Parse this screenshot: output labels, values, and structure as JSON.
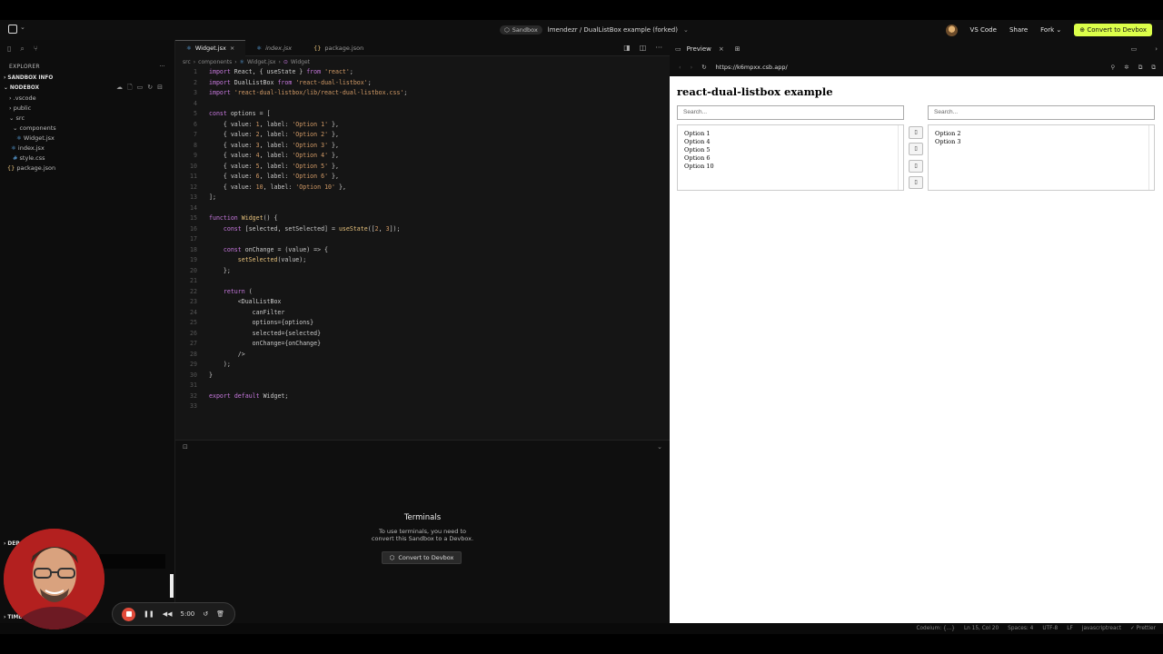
{
  "topbar": {
    "sandbox_label": "Sandbox",
    "project_path": "lmendezr / DualListBox example (forked)",
    "vscode_label": "VS Code",
    "share_label": "Share",
    "fork_label": "Fork",
    "convert_label": "Convert to Devbox"
  },
  "sidebar": {
    "explorer_title": "EXPLORER",
    "items": [
      {
        "label": "SANDBOX INFO",
        "arrow": "›"
      },
      {
        "label": "NODEBOX",
        "arrow": "⌄"
      },
      {
        "label": ".vscode",
        "arrow": "›"
      },
      {
        "label": "public",
        "arrow": "›"
      },
      {
        "label": "src",
        "arrow": "⌄"
      },
      {
        "label": "components",
        "arrow": "⌄"
      },
      {
        "label": "Widget.jsx",
        "icon": "⚛"
      },
      {
        "label": "index.jsx",
        "icon": "⚛"
      },
      {
        "label": "style.css",
        "icon": "#"
      },
      {
        "label": "package.json",
        "icon": "{}"
      }
    ],
    "deps_label": "DEP",
    "timeline_label": "TIMEL"
  },
  "editor": {
    "tabs": [
      {
        "label": "Widget.jsx",
        "icon": "⚛",
        "close": "×"
      },
      {
        "label": "index.jsx",
        "icon": "⚛"
      },
      {
        "label": "package.json",
        "icon": "{}"
      }
    ],
    "breadcrumb": [
      "src",
      "components",
      "Widget.jsx",
      "Widget"
    ],
    "lines": [
      "import React, { useState } from 'react';",
      "import DualListBox from 'react-dual-listbox';",
      "import 'react-dual-listbox/lib/react-dual-listbox.css';",
      "",
      "const options = [",
      "    { value: 1, label: 'Option 1' },",
      "    { value: 2, label: 'Option 2' },",
      "    { value: 3, label: 'Option 3' },",
      "    { value: 4, label: 'Option 4' },",
      "    { value: 5, label: 'Option 5' },",
      "    { value: 6, label: 'Option 6' },",
      "    { value: 10, label: 'Option 10' },",
      "];",
      "",
      "function Widget() {",
      "    const [selected, setSelected] = useState([2, 3]);",
      "",
      "    const onChange = (value) => {",
      "        setSelected(value);",
      "    };",
      "",
      "    return (",
      "        <DualListBox",
      "            canFilter",
      "            options={options}",
      "            selected={selected}",
      "            onChange={onChange}",
      "        />",
      "    );",
      "}",
      "",
      "export default Widget;",
      ""
    ]
  },
  "terminal": {
    "title": "Terminals",
    "message_line1": "To use terminals, you need to",
    "message_line2": "convert this Sandbox to a Devbox.",
    "button_label": "Convert to Devbox"
  },
  "preview": {
    "tab_label": "Preview",
    "url": "https://k6mpxx.csb.app/",
    "heading": "react-dual-listbox example",
    "available_placeholder": "Search...",
    "selected_placeholder": "Search...",
    "available_options": [
      "Option 1",
      "Option 4",
      "Option 5",
      "Option 6",
      "Option 10"
    ],
    "selected_options": [
      "Option 2",
      "Option 3"
    ]
  },
  "statusbar": {
    "items": [
      "Codeium: {...}",
      "Ln 15, Col 20",
      "Spaces: 4",
      "UTF-8",
      "LF",
      "javascriptreact",
      "Prettier"
    ]
  },
  "recorder": {
    "time": "5:00"
  }
}
